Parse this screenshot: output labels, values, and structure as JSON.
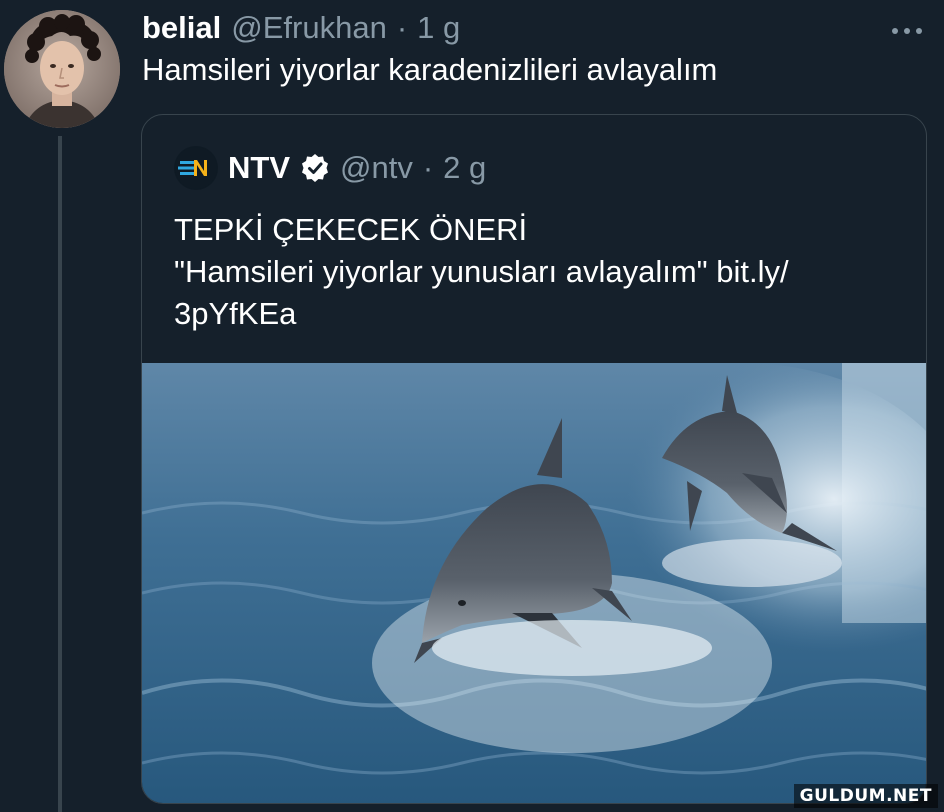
{
  "tweet": {
    "display_name": "belial",
    "handle": "@Efrukhan",
    "separator": "·",
    "time": "1 g",
    "more_icon": "more-icon",
    "text": "Hamsileri yiyorlar karadenizlileri avlayalım"
  },
  "quote": {
    "logo_icon": "ntv-logo-icon",
    "display_name": "NTV",
    "verified_icon": "verified-badge-icon",
    "handle": "@ntv",
    "separator": "·",
    "time": "2 g",
    "text_lines": [
      "TEPKİ ÇEKECEK ÖNERİ",
      "\"Hamsileri yiyorlar yunusları avlayalım\" bit.ly/",
      "3pYfKEa"
    ],
    "image_icon": "dolphins-image"
  },
  "watermark": "GULDUM.NET",
  "colors": {
    "background": "#15202b",
    "border": "#38444d",
    "secondary_text": "#8899a6",
    "primary_text": "#ffffff",
    "verified": "#ffffff"
  }
}
